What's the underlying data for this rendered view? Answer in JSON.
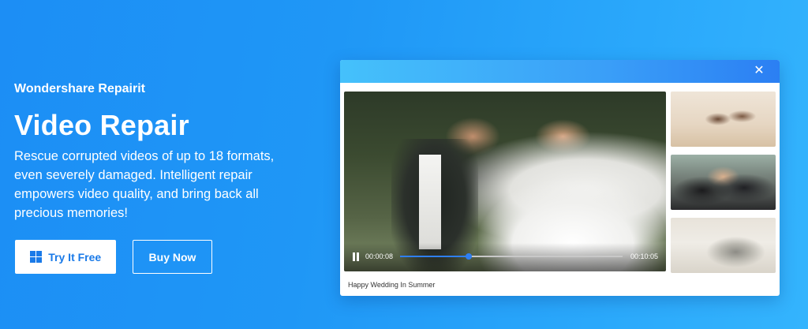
{
  "hero": {
    "brand": "Wondershare Repairit",
    "title": "Video Repair",
    "description": "Rescue corrupted videos of up to 18 formats, even severely damaged. Intelligent repair empowers video quality, and bring back all precious memories!",
    "try_button": "Try It Free",
    "buy_button": "Buy Now",
    "try_icon": "windows-icon"
  },
  "player": {
    "close_icon": "close-icon",
    "close_glyph": "✕",
    "current_time": "00:00:08",
    "total_time": "00:10:05",
    "progress": 0.31,
    "caption": "Happy Wedding In Summer"
  },
  "thumbnails": [
    {
      "name": "family-celebration-thumbnail"
    },
    {
      "name": "graduation-thumbnail"
    },
    {
      "name": "cat-on-bed-thumbnail"
    }
  ],
  "colors": {
    "background": "#1f97f6",
    "accent": "#1a7ae8",
    "progress": "#2f7ff3"
  }
}
